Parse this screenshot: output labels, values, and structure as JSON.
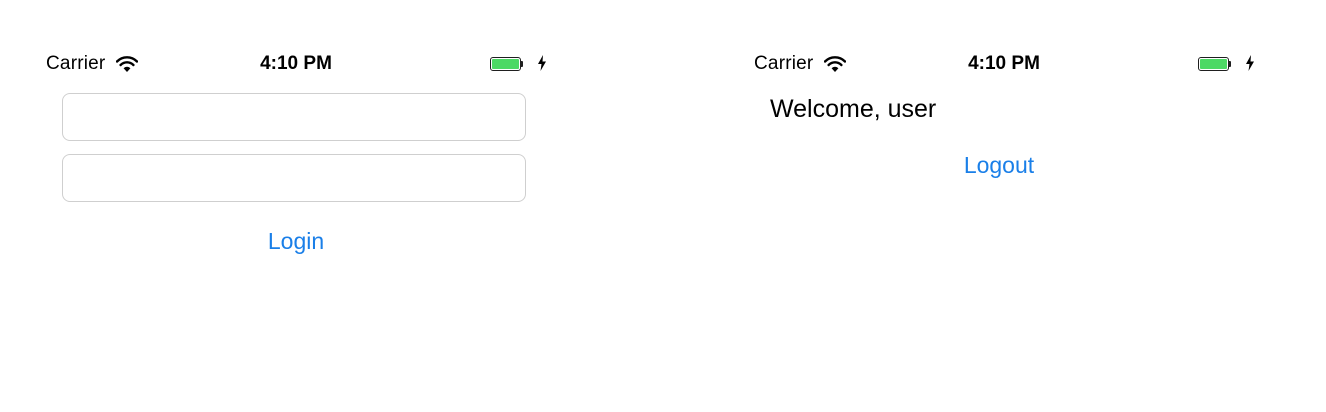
{
  "status_bar": {
    "carrier": "Carrier",
    "time": "4:10 PM",
    "battery_color": "#4cd964"
  },
  "login_screen": {
    "username_field": {
      "value": "",
      "placeholder": ""
    },
    "password_field": {
      "value": "",
      "placeholder": ""
    },
    "login_label": "Login"
  },
  "home_screen": {
    "welcome_text": "Welcome, user",
    "logout_label": "Logout"
  },
  "colors": {
    "link_blue": "#1a7fe8",
    "field_border": "#cfcfcf"
  },
  "icons": [
    "wifi-icon",
    "battery-icon",
    "charging-bolt-icon"
  ]
}
